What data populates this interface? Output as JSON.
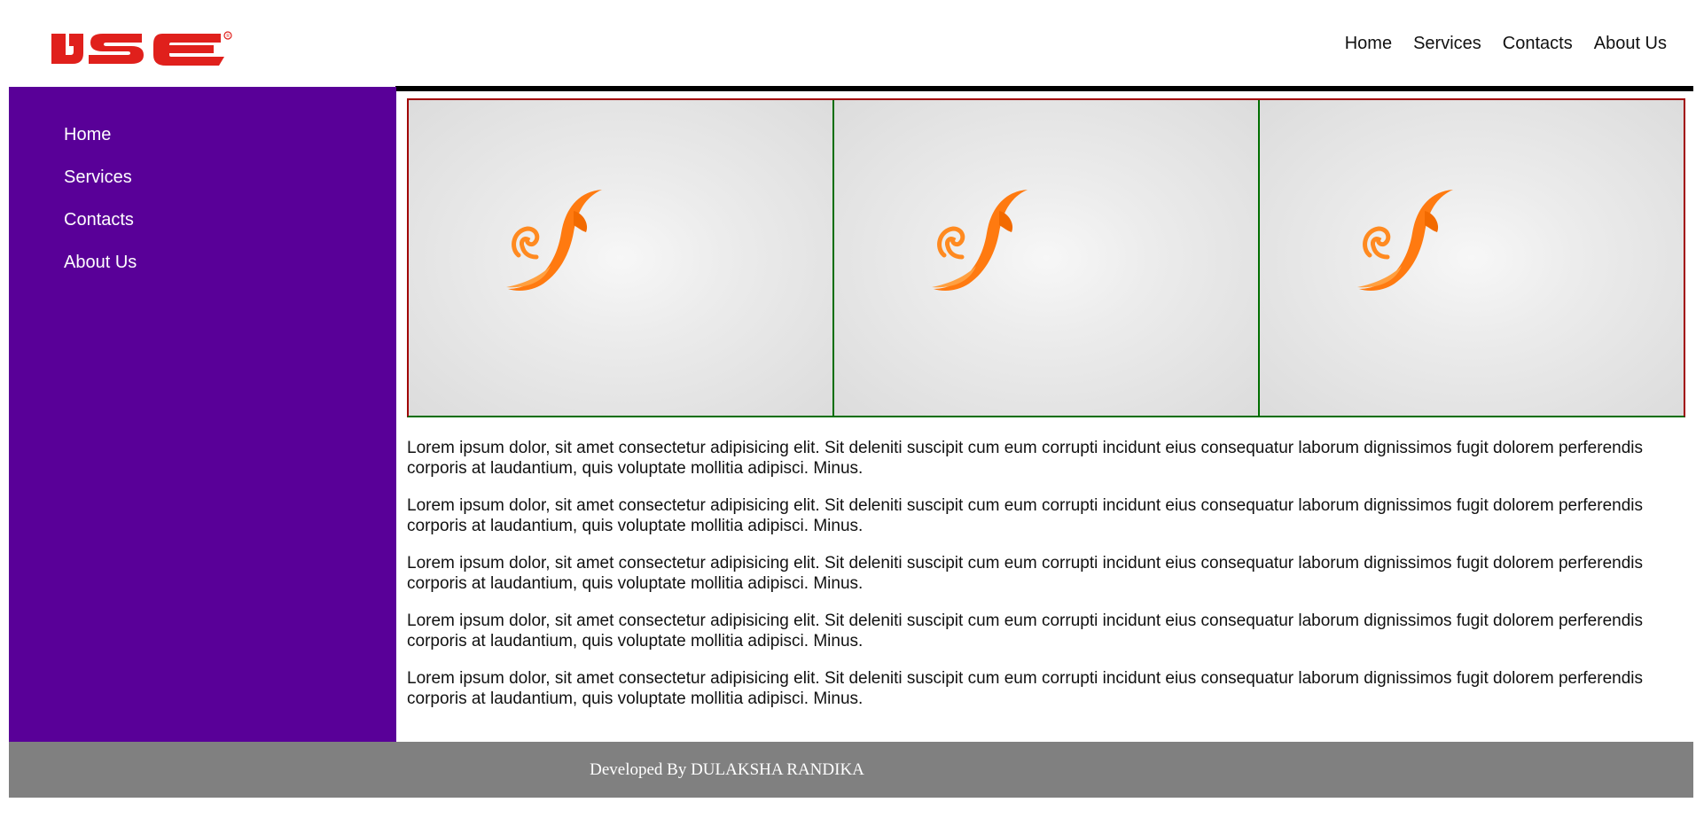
{
  "header": {
    "logo_text": "IJSE",
    "nav": [
      "Home",
      "Services",
      "Contacts",
      "About Us"
    ]
  },
  "sidebar": {
    "items": [
      "Home",
      "Services",
      "Contacts",
      "About Us"
    ]
  },
  "gallery": {
    "panel_count": 3,
    "image_name": "orange-swirl-logo",
    "outer_border_color": "#a10000",
    "divider_color": "#006e00"
  },
  "content": {
    "paragraphs": [
      "Lorem ipsum dolor, sit amet consectetur adipisicing elit. Sit deleniti suscipit cum eum corrupti incidunt eius consequatur laborum dignissimos fugit dolorem perferendis corporis at laudantium, quis voluptate mollitia adipisci. Minus.",
      "Lorem ipsum dolor, sit amet consectetur adipisicing elit. Sit deleniti suscipit cum eum corrupti incidunt eius consequatur laborum dignissimos fugit dolorem perferendis corporis at laudantium, quis voluptate mollitia adipisci. Minus.",
      "Lorem ipsum dolor, sit amet consectetur adipisicing elit. Sit deleniti suscipit cum eum corrupti incidunt eius consequatur laborum dignissimos fugit dolorem perferendis corporis at laudantium, quis voluptate mollitia adipisci. Minus.",
      "Lorem ipsum dolor, sit amet consectetur adipisicing elit. Sit deleniti suscipit cum eum corrupti incidunt eius consequatur laborum dignissimos fugit dolorem perferendis corporis at laudantium, quis voluptate mollitia adipisci. Minus.",
      "Lorem ipsum dolor, sit amet consectetur adipisicing elit. Sit deleniti suscipit cum eum corrupti incidunt eius consequatur laborum dignissimos fugit dolorem perferendis corporis at laudantium, quis voluptate mollitia adipisci. Minus."
    ]
  },
  "footer": {
    "text": "Developed By DULAKSHA RANDIKA"
  },
  "colors": {
    "sidebar_bg": "#590098",
    "footer_bg": "#808080",
    "logo_red": "#e0201c",
    "swirl_orange": "#ff7a10"
  }
}
